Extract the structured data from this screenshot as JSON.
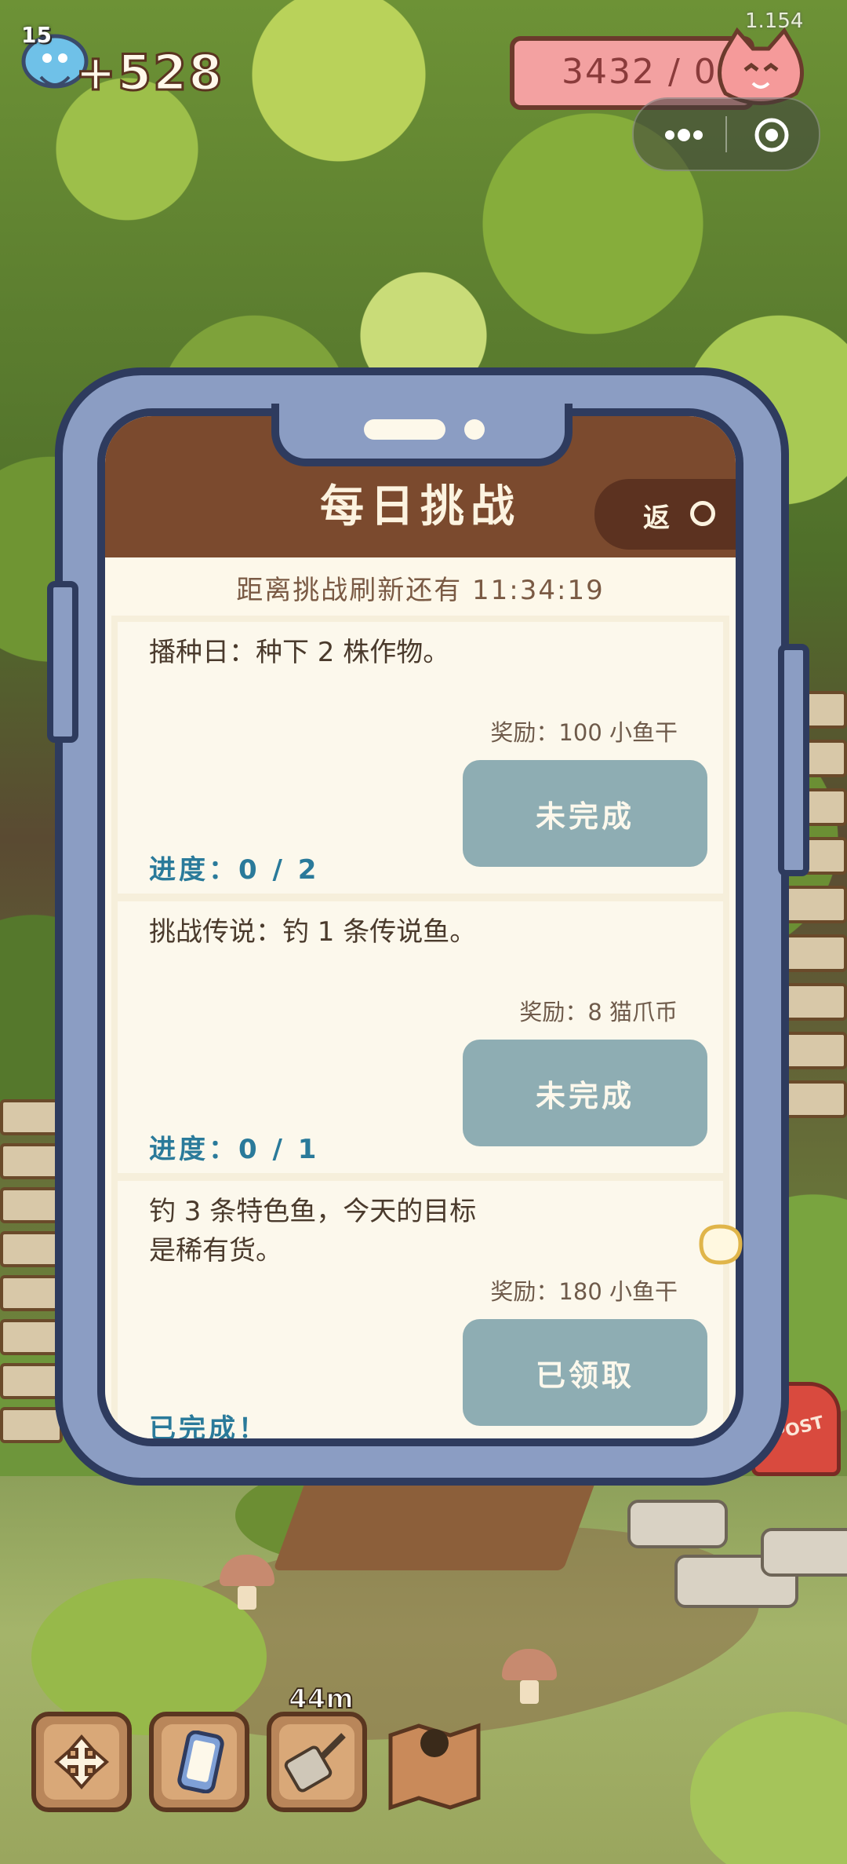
{
  "hud": {
    "level": "15",
    "gem_count": "+528",
    "version": "1.154",
    "coin_value": "3432 / 0",
    "icons": [
      "blue-gem-icon",
      "cat-face-icon",
      "more-dots-icon",
      "close-circle-icon"
    ]
  },
  "panel": {
    "title": "每日挑战",
    "back_label": "返",
    "refresh_text": "距离挑战刷新还有 11:34:19",
    "challenges": [
      {
        "description": "播种日：种下 2 株作物。",
        "reward": "奖励：100 小鱼干",
        "button": "未完成",
        "progress": "进度：0 / 2"
      },
      {
        "description": "挑战传说：钓 1 条传说鱼。",
        "reward": "奖励：8 猫爪币",
        "button": "未完成",
        "progress": "进度：0 / 1"
      },
      {
        "description": "钓 3 条特色鱼，今天的目标是稀有货。",
        "reward": "奖励：180 小鱼干",
        "button": "已领取",
        "progress": "已完成！"
      }
    ]
  },
  "toolbar": {
    "timer": "44m",
    "tools": [
      "move-arrows-icon",
      "phone-icon",
      "fishing-net-icon",
      "map-icon"
    ]
  },
  "scene": {
    "mailbox_text": "POST"
  },
  "colors": {
    "header": "#7b4a2e",
    "button": "#8eadb3",
    "progress": "#2a7a9a",
    "phone_frame": "#8b9dc3",
    "coin_bar": "#f3a1a1"
  }
}
